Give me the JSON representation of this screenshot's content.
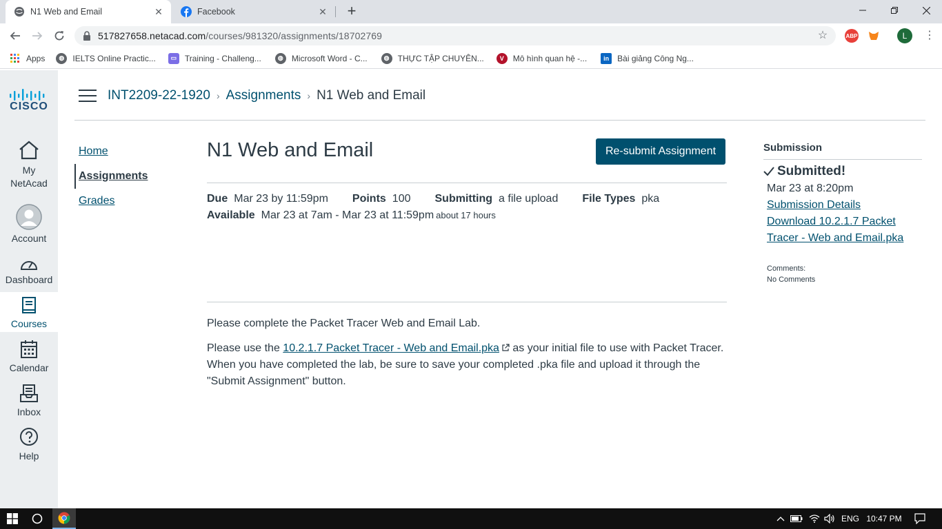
{
  "browser": {
    "tabs": [
      {
        "title": "N1 Web and Email",
        "active": true,
        "icon": "globe-icon"
      },
      {
        "title": "Facebook",
        "active": false,
        "icon": "facebook-icon"
      }
    ],
    "url_host": "517827658.netacad.com",
    "url_path": "/courses/981320/assignments/18702769",
    "profile_initial": "L",
    "extension_abp": "ABP",
    "bookmarks": [
      {
        "label": "Apps",
        "icon": "apps-grid-icon"
      },
      {
        "label": "IELTS Online Practic...",
        "icon": "globe-icon"
      },
      {
        "label": "Training - Challeng...",
        "icon": "training-icon"
      },
      {
        "label": "Microsoft Word - C...",
        "icon": "globe-icon"
      },
      {
        "label": "THỰC TẬP CHUYÊN...",
        "icon": "globe-icon"
      },
      {
        "label": "Mô hình quan hệ -...",
        "icon": "v-icon"
      },
      {
        "label": "Bài giảng Công Ng...",
        "icon": "linkedin-icon"
      }
    ]
  },
  "global_nav": {
    "logo_text": "CISCO",
    "items": [
      {
        "label": "My NetAcad",
        "icon": "home-icon",
        "active": false
      },
      {
        "label": "Account",
        "icon": "avatar-icon",
        "active": false
      },
      {
        "label": "Dashboard",
        "icon": "dashboard-icon",
        "active": false
      },
      {
        "label": "Courses",
        "icon": "book-icon",
        "active": true
      },
      {
        "label": "Calendar",
        "icon": "calendar-icon",
        "active": false
      },
      {
        "label": "Inbox",
        "icon": "inbox-icon",
        "active": false
      },
      {
        "label": "Help",
        "icon": "help-icon",
        "active": false
      }
    ]
  },
  "breadcrumb": {
    "course": "INT2209-22-1920",
    "section": "Assignments",
    "current": "N1 Web and Email"
  },
  "course_nav": {
    "items": [
      {
        "label": "Home",
        "active": false
      },
      {
        "label": "Assignments",
        "active": true
      },
      {
        "label": "Grades",
        "active": false
      }
    ]
  },
  "assignment": {
    "title": "N1 Web and Email",
    "resubmit_label": "Re-submit Assignment",
    "due_label": "Due",
    "due_value": "Mar 23 by 11:59pm",
    "points_label": "Points",
    "points_value": "100",
    "submitting_label": "Submitting",
    "submitting_value": "a file upload",
    "filetypes_label": "File Types",
    "filetypes_value": "pka",
    "available_label": "Available",
    "available_value": "Mar 23 at 7am - Mar 23 at 11:59pm",
    "available_duration": "about 17 hours",
    "desc_p1": "Please complete the Packet Tracer Web and Email Lab.",
    "desc_p2_before": "Please use the ",
    "desc_p2_link": "10.2.1.7 Packet Tracer - Web and Email.pka",
    "desc_p2_after": " as your initial file to use with Packet Tracer. When you have completed the lab, be sure to save your completed .pka file and upload it through the \"Submit Assignment\" button."
  },
  "submission": {
    "heading": "Submission",
    "status": "Submitted!",
    "date": "Mar 23 at 8:20pm",
    "details_link": "Submission Details",
    "download_link": "Download 10.2.1.7 Packet Tracer - Web and Email.pka",
    "comments_label": "Comments:",
    "comments_value": "No Comments"
  },
  "taskbar": {
    "language": "ENG",
    "time": "10:47 PM"
  },
  "colors": {
    "brand": "#00506e",
    "text": "#2d3b45",
    "nav_bg": "#ebeef0"
  }
}
